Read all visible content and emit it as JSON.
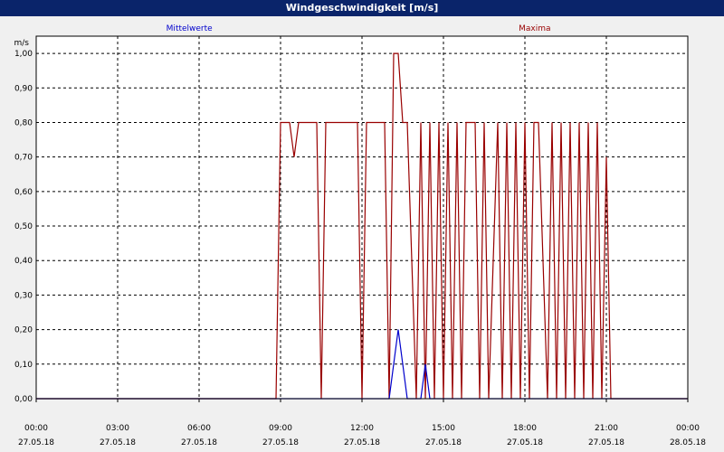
{
  "window": {
    "title": "Windgeschwindigkeit [m/s]"
  },
  "chart_data": {
    "type": "line",
    "title": "Windgeschwindigkeit [m/s]",
    "ylabel": "m/s",
    "xlabel": "",
    "ylim": [
      0,
      1.05
    ],
    "xlim": [
      "2018-05-27T00:00",
      "2018-05-28T00:00"
    ],
    "grid": true,
    "x_ticks": [
      {
        "time": "00:00",
        "date": "27.05.18"
      },
      {
        "time": "03:00",
        "date": "27.05.18"
      },
      {
        "time": "06:00",
        "date": "27.05.18"
      },
      {
        "time": "09:00",
        "date": "27.05.18"
      },
      {
        "time": "12:00",
        "date": "27.05.18"
      },
      {
        "time": "15:00",
        "date": "27.05.18"
      },
      {
        "time": "18:00",
        "date": "27.05.18"
      },
      {
        "time": "21:00",
        "date": "27.05.18"
      },
      {
        "time": "00:00",
        "date": "28.05.18"
      }
    ],
    "y_ticks": [
      "0,00",
      "0,10",
      "0,20",
      "0,30",
      "0,40",
      "0,50",
      "0,60",
      "0,70",
      "0,80",
      "0,90",
      "1,00"
    ],
    "series": [
      {
        "name": "Mittelwerte",
        "color": "#0000cc",
        "x": [
          "00:00",
          "13:00",
          "13:20",
          "13:40",
          "14:10",
          "14:20",
          "14:30",
          "24:00"
        ],
        "y": [
          0,
          0,
          0.2,
          0,
          0,
          0.1,
          0,
          0
        ]
      },
      {
        "name": "Maxima",
        "color": "#990000",
        "x": [
          "00:00",
          "08:50",
          "09:00",
          "09:20",
          "09:30",
          "09:40",
          "10:20",
          "10:30",
          "10:40",
          "11:50",
          "12:00",
          "12:10",
          "12:50",
          "13:00",
          "13:10",
          "13:20",
          "13:30",
          "13:40",
          "14:00",
          "14:10",
          "14:20",
          "14:30",
          "14:40",
          "14:50",
          "15:00",
          "15:10",
          "15:20",
          "15:30",
          "15:40",
          "15:50",
          "16:10",
          "16:20",
          "16:30",
          "16:40",
          "17:00",
          "17:10",
          "17:20",
          "17:30",
          "17:40",
          "17:50",
          "18:00",
          "18:10",
          "18:20",
          "18:30",
          "18:50",
          "19:00",
          "19:10",
          "19:20",
          "19:30",
          "19:40",
          "19:50",
          "20:00",
          "20:10",
          "20:20",
          "20:30",
          "20:40",
          "20:50",
          "21:00",
          "21:10",
          "21:20",
          "24:00"
        ],
        "y": [
          0,
          0,
          0.8,
          0.8,
          0.7,
          0.8,
          0.8,
          0,
          0.8,
          0.8,
          0,
          0.8,
          0.8,
          0,
          1.0,
          1.0,
          0.8,
          0.8,
          0,
          0.8,
          0,
          0.8,
          0,
          0.8,
          0,
          0.8,
          0,
          0.8,
          0,
          0.8,
          0.8,
          0,
          0.8,
          0,
          0.8,
          0,
          0.8,
          0,
          0.8,
          0,
          0.8,
          0,
          0.8,
          0.8,
          0,
          0.8,
          0,
          0.8,
          0,
          0.8,
          0,
          0.8,
          0,
          0.8,
          0,
          0.8,
          0,
          0.7,
          0,
          0,
          0
        ]
      }
    ]
  }
}
